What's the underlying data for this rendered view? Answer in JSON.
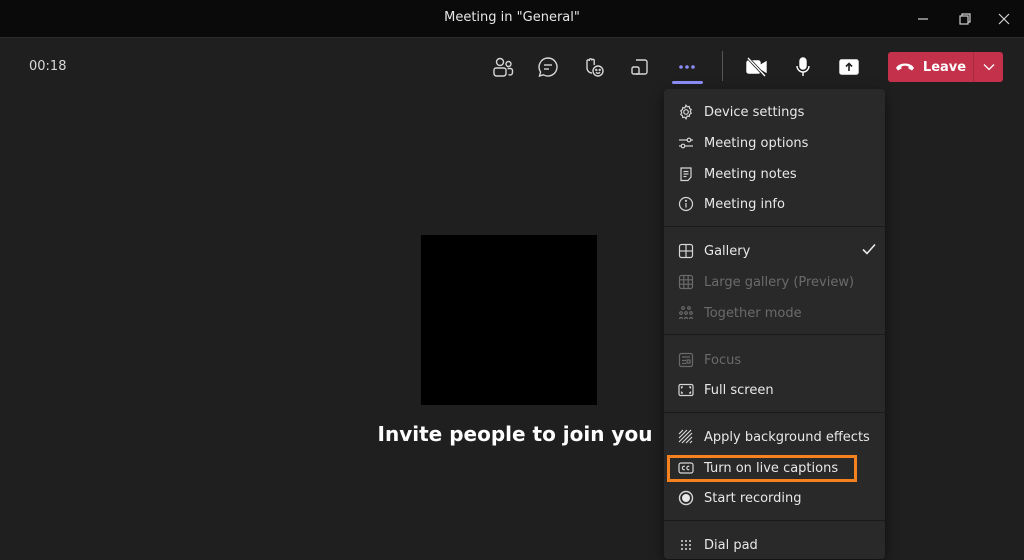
{
  "window": {
    "title": "Meeting in \"General\"",
    "controls": [
      "minimize-icon",
      "restore-icon",
      "close-icon"
    ]
  },
  "toolbar": {
    "timer": "00:18",
    "buttons": [
      {
        "name": "participants",
        "icon": "people-icon"
      },
      {
        "name": "chat",
        "icon": "chat-icon"
      },
      {
        "name": "reactions",
        "icon": "raise-hand-emoji-icon"
      },
      {
        "name": "rooms",
        "icon": "breakout-rooms-icon"
      },
      {
        "name": "more-actions",
        "icon": "more-icon",
        "active": true
      },
      {
        "name": "camera",
        "icon": "camera-off-icon"
      },
      {
        "name": "mic",
        "icon": "microphone-icon"
      },
      {
        "name": "share",
        "icon": "share-tray-icon"
      }
    ],
    "leave_label": "Leave",
    "accent_color": "#8b8cf7",
    "leave_color": "#c4314b"
  },
  "stage": {
    "invite_text": "Invite people to join you"
  },
  "menu": {
    "groups": [
      [
        {
          "label": "Device settings",
          "icon": "gear-icon",
          "enabled": true
        },
        {
          "label": "Meeting options",
          "icon": "sliders-icon",
          "enabled": true
        },
        {
          "label": "Meeting notes",
          "icon": "notes-icon",
          "enabled": true
        },
        {
          "label": "Meeting info",
          "icon": "info-icon",
          "enabled": true
        }
      ],
      [
        {
          "label": "Gallery",
          "icon": "gallery-icon",
          "enabled": true,
          "checked": true
        },
        {
          "label": "Large gallery (Preview)",
          "icon": "large-gallery-icon",
          "enabled": false
        },
        {
          "label": "Together mode",
          "icon": "together-mode-icon",
          "enabled": false
        }
      ],
      [
        {
          "label": "Focus",
          "icon": "focus-icon",
          "enabled": false
        },
        {
          "label": "Full screen",
          "icon": "fullscreen-icon",
          "enabled": true
        }
      ],
      [
        {
          "label": "Apply background effects",
          "icon": "background-effects-icon",
          "enabled": true
        },
        {
          "label": "Turn on live captions",
          "icon": "cc-icon",
          "enabled": true,
          "highlighted": true
        },
        {
          "label": "Start recording",
          "icon": "record-icon",
          "enabled": true
        }
      ],
      [
        {
          "label": "Dial pad",
          "icon": "dialpad-icon",
          "enabled": true
        }
      ]
    ],
    "highlight_color": "#f5821f"
  }
}
